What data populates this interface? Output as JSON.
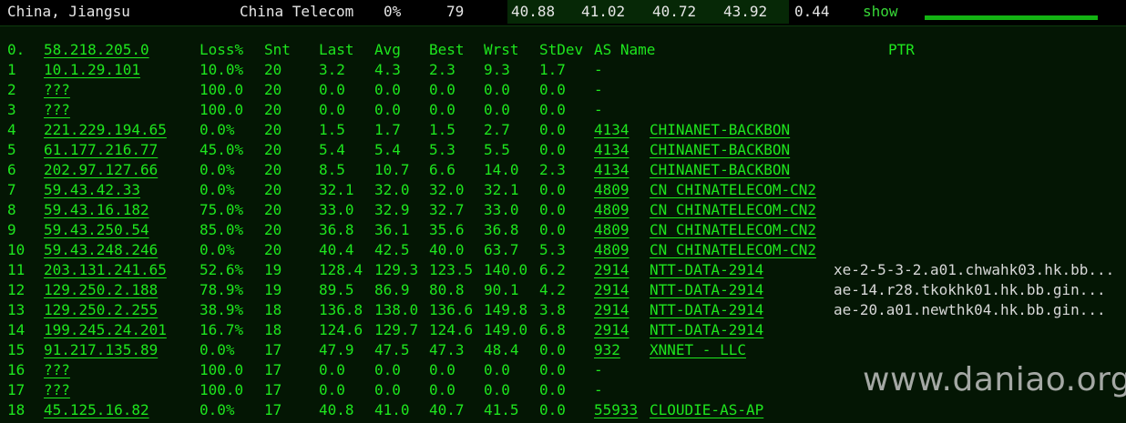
{
  "summary": {
    "location": "China, Jiangsu",
    "isp": "China Telecom",
    "loss": "0%",
    "sent": "79",
    "last": "40.88",
    "avg": "41.02",
    "best": "40.72",
    "worst": "43.92",
    "stdev": "0.44",
    "show_label": "show"
  },
  "header": {
    "hop": "0.",
    "host": "58.218.205.0",
    "loss": "Loss%",
    "snt": "Snt",
    "last": "Last",
    "avg": "Avg",
    "best": "Best",
    "wrst": "Wrst",
    "stdev": "StDev",
    "asname": "AS Name",
    "ptr": "PTR"
  },
  "hops": [
    {
      "hop": "1",
      "host": "10.1.29.101",
      "loss": "10.0%",
      "snt": "20",
      "last": "3.2",
      "avg": "4.3",
      "best": "2.3",
      "wrst": "9.3",
      "stdev": "1.7",
      "as": "-",
      "asname": "",
      "ptr": ""
    },
    {
      "hop": "2",
      "host": "???",
      "loss": "100.0",
      "snt": "20",
      "last": "0.0",
      "avg": "0.0",
      "best": "0.0",
      "wrst": "0.0",
      "stdev": "0.0",
      "as": "-",
      "asname": "",
      "ptr": ""
    },
    {
      "hop": "3",
      "host": "???",
      "loss": "100.0",
      "snt": "20",
      "last": "0.0",
      "avg": "0.0",
      "best": "0.0",
      "wrst": "0.0",
      "stdev": "0.0",
      "as": "-",
      "asname": "",
      "ptr": ""
    },
    {
      "hop": "4",
      "host": "221.229.194.65",
      "loss": "0.0%",
      "snt": "20",
      "last": "1.5",
      "avg": "1.7",
      "best": "1.5",
      "wrst": "2.7",
      "stdev": "0.0",
      "as": "4134",
      "asname": "CHINANET-BACKBON",
      "ptr": ""
    },
    {
      "hop": "5",
      "host": "61.177.216.77",
      "loss": "45.0%",
      "snt": "20",
      "last": "5.4",
      "avg": "5.4",
      "best": "5.3",
      "wrst": "5.5",
      "stdev": "0.0",
      "as": "4134",
      "asname": "CHINANET-BACKBON",
      "ptr": ""
    },
    {
      "hop": "6",
      "host": "202.97.127.66",
      "loss": "0.0%",
      "snt": "20",
      "last": "8.5",
      "avg": "10.7",
      "best": "6.6",
      "wrst": "14.0",
      "stdev": "2.3",
      "as": "4134",
      "asname": "CHINANET-BACKBON",
      "ptr": ""
    },
    {
      "hop": "7",
      "host": "59.43.42.33",
      "loss": "0.0%",
      "snt": "20",
      "last": "32.1",
      "avg": "32.0",
      "best": "32.0",
      "wrst": "32.1",
      "stdev": "0.0",
      "as": "4809",
      "asname": "CN CHINATELECOM-CN2",
      "ptr": ""
    },
    {
      "hop": "8",
      "host": "59.43.16.182",
      "loss": "75.0%",
      "snt": "20",
      "last": "33.0",
      "avg": "32.9",
      "best": "32.7",
      "wrst": "33.0",
      "stdev": "0.0",
      "as": "4809",
      "asname": "CN CHINATELECOM-CN2",
      "ptr": ""
    },
    {
      "hop": "9",
      "host": "59.43.250.54",
      "loss": "85.0%",
      "snt": "20",
      "last": "36.8",
      "avg": "36.1",
      "best": "35.6",
      "wrst": "36.8",
      "stdev": "0.0",
      "as": "4809",
      "asname": "CN CHINATELECOM-CN2",
      "ptr": ""
    },
    {
      "hop": "10",
      "host": "59.43.248.246",
      "loss": "0.0%",
      "snt": "20",
      "last": "40.4",
      "avg": "42.5",
      "best": "40.0",
      "wrst": "63.7",
      "stdev": "5.3",
      "as": "4809",
      "asname": "CN CHINATELECOM-CN2",
      "ptr": ""
    },
    {
      "hop": "11",
      "host": "203.131.241.65",
      "loss": "52.6%",
      "snt": "19",
      "last": "128.4",
      "avg": "129.3",
      "best": "123.5",
      "wrst": "140.0",
      "stdev": "6.2",
      "as": "2914",
      "asname": "NTT-DATA-2914",
      "ptr": "xe-2-5-3-2.a01.chwahk03.hk.bb..."
    },
    {
      "hop": "12",
      "host": "129.250.2.188",
      "loss": "78.9%",
      "snt": "19",
      "last": "89.5",
      "avg": "86.9",
      "best": "80.8",
      "wrst": "90.1",
      "stdev": "4.2",
      "as": "2914",
      "asname": "NTT-DATA-2914",
      "ptr": "ae-14.r28.tkokhk01.hk.bb.gin..."
    },
    {
      "hop": "13",
      "host": "129.250.2.255",
      "loss": "38.9%",
      "snt": "18",
      "last": "136.8",
      "avg": "138.0",
      "best": "136.6",
      "wrst": "149.8",
      "stdev": "3.8",
      "as": "2914",
      "asname": "NTT-DATA-2914",
      "ptr": "ae-20.a01.newthk04.hk.bb.gin..."
    },
    {
      "hop": "14",
      "host": "199.245.24.201",
      "loss": "16.7%",
      "snt": "18",
      "last": "124.6",
      "avg": "129.7",
      "best": "124.6",
      "wrst": "149.0",
      "stdev": "6.8",
      "as": "2914",
      "asname": "NTT-DATA-2914",
      "ptr": ""
    },
    {
      "hop": "15",
      "host": "91.217.135.89",
      "loss": "0.0%",
      "snt": "17",
      "last": "47.9",
      "avg": "47.5",
      "best": "47.3",
      "wrst": "48.4",
      "stdev": "0.0",
      "as": "932",
      "asname": "XNNET - LLC",
      "ptr": ""
    },
    {
      "hop": "16",
      "host": "???",
      "loss": "100.0",
      "snt": "17",
      "last": "0.0",
      "avg": "0.0",
      "best": "0.0",
      "wrst": "0.0",
      "stdev": "0.0",
      "as": "-",
      "asname": "",
      "ptr": ""
    },
    {
      "hop": "17",
      "host": "???",
      "loss": "100.0",
      "snt": "17",
      "last": "0.0",
      "avg": "0.0",
      "best": "0.0",
      "wrst": "0.0",
      "stdev": "0.0",
      "as": "-",
      "asname": "",
      "ptr": ""
    },
    {
      "hop": "18",
      "host": "45.125.16.82",
      "loss": "0.0%",
      "snt": "17",
      "last": "40.8",
      "avg": "41.0",
      "best": "40.7",
      "wrst": "41.5",
      "stdev": "0.0",
      "as": "55933",
      "asname": "CLOUDIE-AS-AP",
      "ptr": ""
    }
  ],
  "watermark": "www.daniao.org",
  "colors": {
    "text_green": "#1ee61e",
    "panel_bg": "#041604",
    "stat_band_bg": "#062806",
    "sparkbar": "#13b313",
    "header_text": "#e6e6e6"
  }
}
